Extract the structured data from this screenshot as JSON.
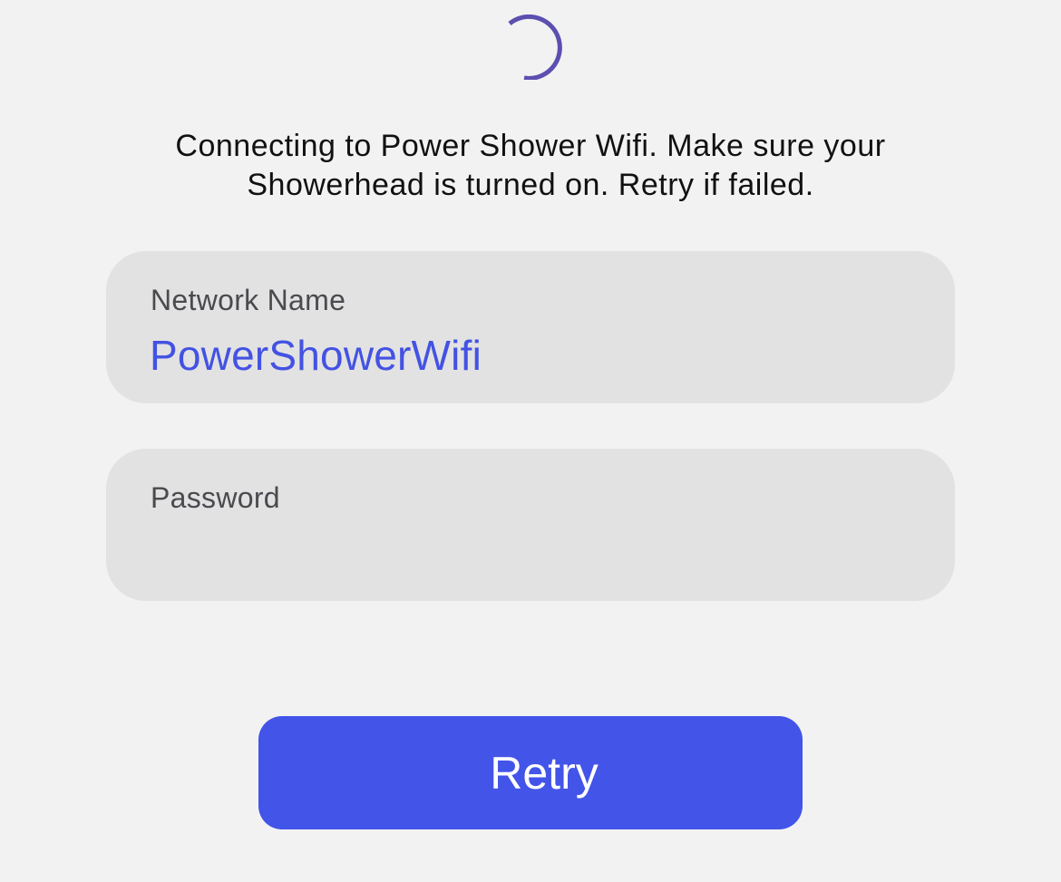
{
  "status": {
    "spinner_icon": "loading-spinner-icon",
    "spinner_color": "#5b4fb0",
    "message": "Connecting to Power Shower Wifi. Make sure your Showerhead is turned on. Retry if failed."
  },
  "network_field": {
    "label": "Network Name",
    "value": "PowerShowerWifi",
    "value_color": "#4352e3"
  },
  "password_field": {
    "label": "Password",
    "value": ""
  },
  "actions": {
    "retry_label": "Retry",
    "retry_color": "#4354e8"
  }
}
